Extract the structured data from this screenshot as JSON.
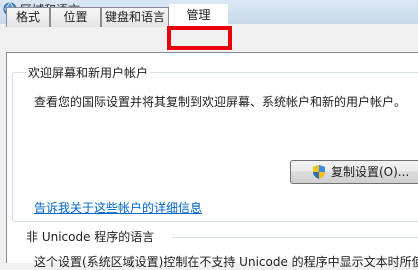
{
  "window": {
    "title": "区域和语言",
    "icon": "globe-icon"
  },
  "tabs": [
    {
      "label": "格式"
    },
    {
      "label": "位置"
    },
    {
      "label": "键盘和语言"
    },
    {
      "label": "管理",
      "selected": true
    }
  ],
  "highlight_color": "#e8000d",
  "welcome_group": {
    "legend": "欢迎屏幕和新用户帐户",
    "description": "查看您的国际设置并将其复制到欢迎屏幕、系统帐户和新的用户帐户。",
    "copy_button": {
      "label": "复制设置(O)...",
      "icon": "shield-icon"
    },
    "link": "告诉我关于这些帐户的详细信息"
  },
  "non_unicode": {
    "title": "非 Unicode 程序的语言",
    "text": "这个设置(系统区域设置)控制在不支持 Unicode 的程序中显示文本时所使用"
  },
  "colors": {
    "link": "#0066cc",
    "accent": "#e8000d"
  }
}
